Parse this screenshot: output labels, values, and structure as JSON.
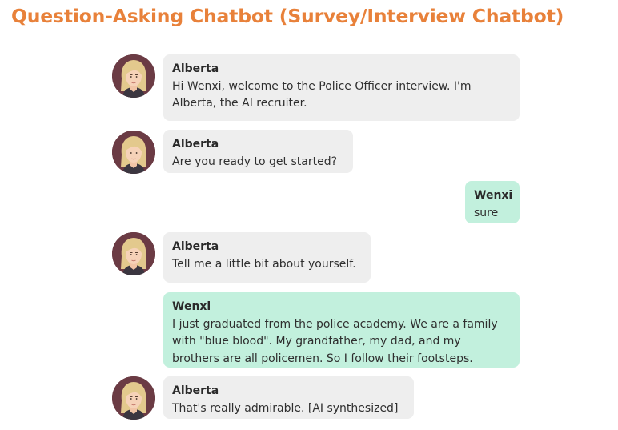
{
  "title": "Question-Asking Chatbot (Survey/Interview Chatbot)",
  "colors": {
    "title": "#e8813a",
    "bot_bubble": "#eeeeee",
    "user_bubble": "#c2f0dd"
  },
  "messages": [
    {
      "sender": "Alberta",
      "role": "bot",
      "avatar": "alberta-avatar",
      "text": "Hi Wenxi, welcome to the Police Officer interview. I'm\nAlberta, the AI recruiter."
    },
    {
      "sender": "Alberta",
      "role": "bot",
      "avatar": "alberta-avatar",
      "text": "Are you ready to get started?"
    },
    {
      "sender": "Wenxi",
      "role": "user",
      "text": "sure"
    },
    {
      "sender": "Alberta",
      "role": "bot",
      "avatar": "alberta-avatar",
      "text": "Tell me a little bit about yourself."
    },
    {
      "sender": "Wenxi",
      "role": "user",
      "text": "I just graduated from the police academy. We are a family\nwith \"blue blood\". My grandfather, my dad, and my\nbrothers are all policemen. So I follow their footsteps."
    },
    {
      "sender": "Alberta",
      "role": "bot",
      "avatar": "alberta-avatar",
      "text": "That's really admirable. [AI synthesized]"
    }
  ]
}
